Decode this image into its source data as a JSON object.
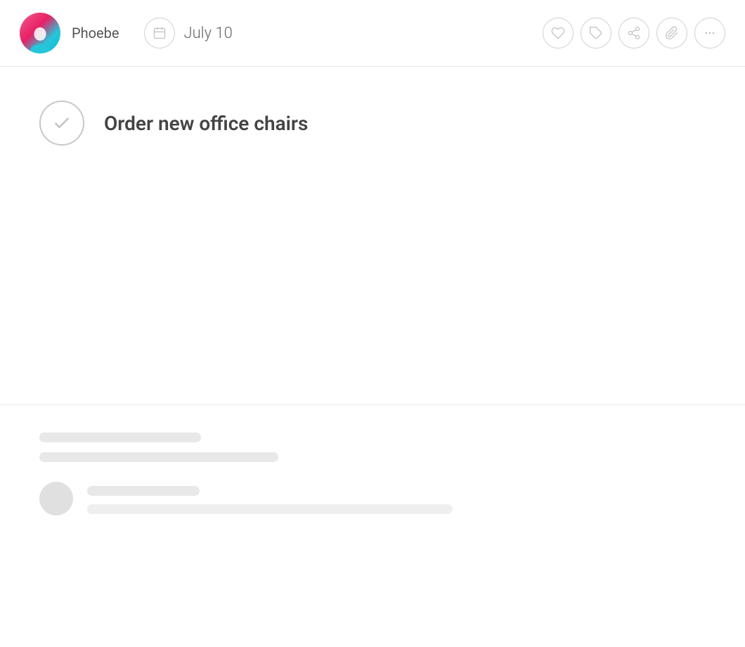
{
  "header": {
    "user_name": "Phoebe",
    "date": "July 10",
    "avatar_alt": "Phoebe avatar"
  },
  "toolbar": {
    "calendar_icon": "calendar-icon",
    "heart_icon": "heart-icon",
    "tag_icon": "tag-icon",
    "share_icon": "share-icon",
    "attachment_icon": "attachment-icon",
    "more_icon": "more-icon"
  },
  "task": {
    "title": "Order new office chairs",
    "completed": false
  },
  "colors": {
    "avatar_gradient_start": "#f06292",
    "avatar_gradient_end": "#26c6da",
    "accent": "#e91e63",
    "border": "#d0d0d0",
    "text_primary": "#444444",
    "text_secondary": "#666666",
    "skeleton": "#e8e8e8"
  }
}
